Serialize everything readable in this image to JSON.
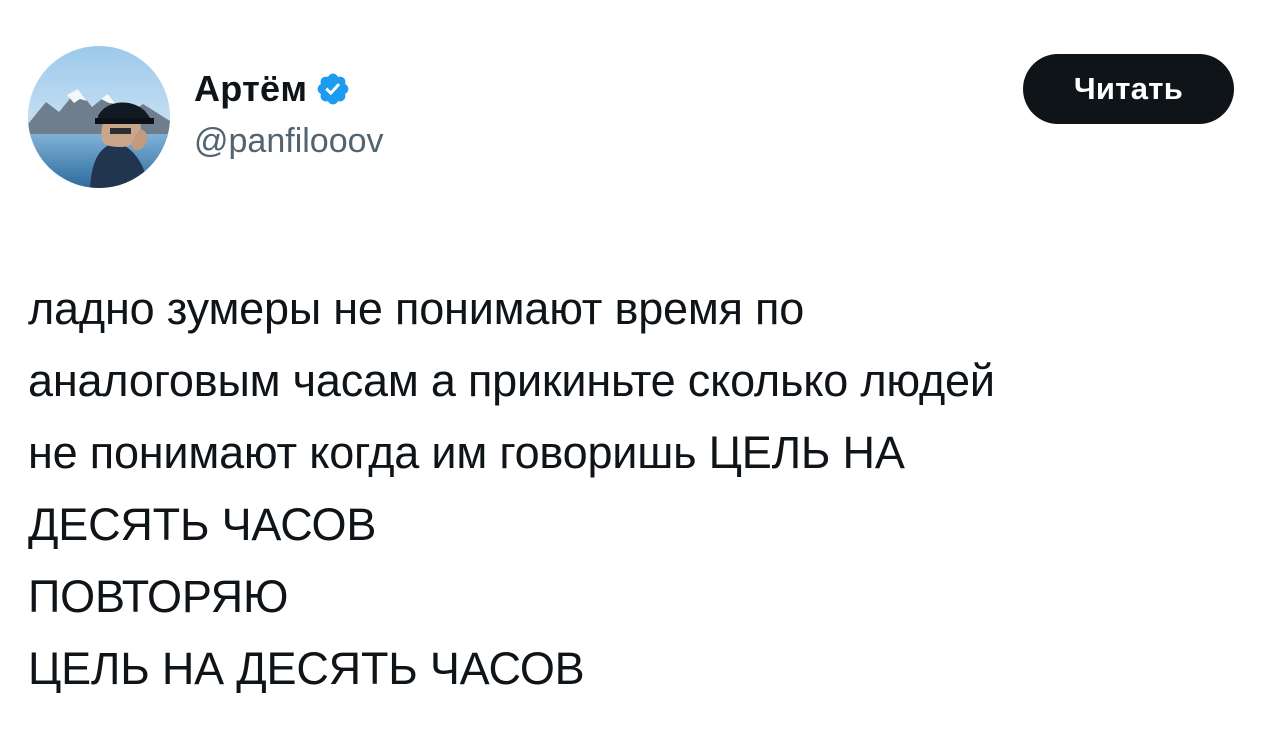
{
  "author": {
    "name": "Артём",
    "handle": "@panfilooov",
    "verified_icon": "verified-badge-icon"
  },
  "actions": {
    "read_label": "Читать"
  },
  "tweet": {
    "lines": [
      "ладно зумеры не понимают время по",
      "аналоговым часам а прикиньте сколько людей",
      "не понимают когда им говоришь ЦЕЛЬ НА",
      "ДЕСЯТЬ ЧАСОВ",
      "ПОВТОРЯЮ",
      "ЦЕЛЬ НА ДЕСЯТЬ ЧАСОВ"
    ]
  },
  "colors": {
    "text_primary": "#0f1419",
    "text_secondary": "#536471",
    "button_background": "#0f1419",
    "button_text": "#ffffff",
    "verified": "#1d9bf0"
  }
}
